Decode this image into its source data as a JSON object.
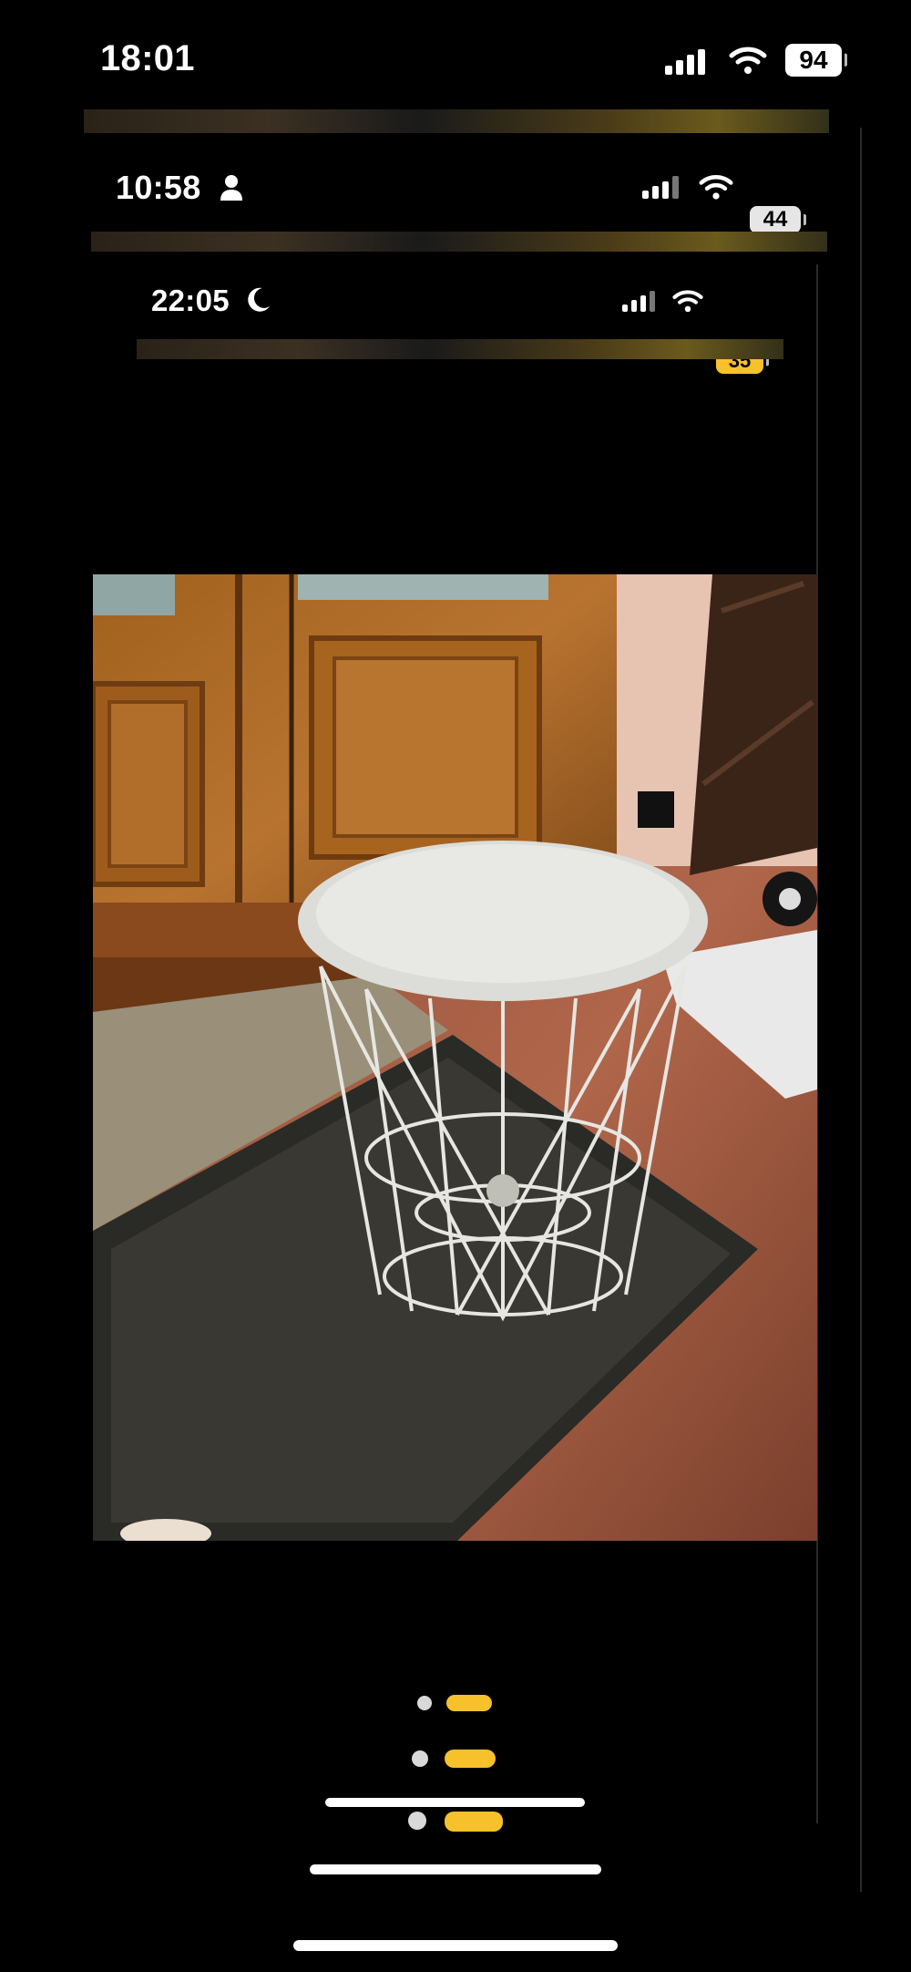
{
  "status_bars": [
    {
      "time": "18:01",
      "battery": "94",
      "extra_icon": ""
    },
    {
      "time": "10:58",
      "battery": "44",
      "extra_icon": "person-icon"
    },
    {
      "time": "22:05",
      "battery": "35",
      "extra_icon": "moon-icon"
    }
  ],
  "colors": {
    "background": "#000000",
    "battery_low_power": "#f6c12a",
    "page_dot_active": "#f6c12a",
    "page_dot_inactive": "#d9d9d9"
  },
  "photo": {
    "subject": "white-wire-basket-side-table-icon"
  }
}
